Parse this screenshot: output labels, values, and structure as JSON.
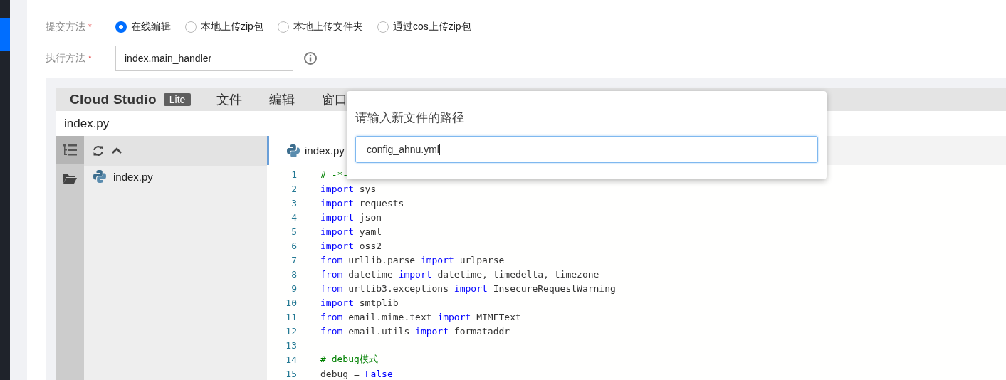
{
  "form": {
    "submit_method": {
      "label": "提交方法",
      "required_mark": "*",
      "options": [
        {
          "label": "在线编辑",
          "selected": true
        },
        {
          "label": "本地上传zip包",
          "selected": false
        },
        {
          "label": "本地上传文件夹",
          "selected": false
        },
        {
          "label": "通过cos上传zip包",
          "selected": false
        }
      ]
    },
    "handler": {
      "label": "执行方法",
      "required_mark": "*",
      "value": "index.main_handler"
    }
  },
  "ide": {
    "brand": "Cloud Studio",
    "badge": "Lite",
    "menu": [
      "文件",
      "编辑",
      "窗口"
    ],
    "title": "index.py",
    "file_tree": [
      {
        "name": "index.py",
        "selected": false
      }
    ],
    "tabs": [
      {
        "label": "index.py",
        "selected": true
      }
    ],
    "lines": [
      {
        "number": "1",
        "tokens": [
          {
            "kind": "comment",
            "text": "# -*-"
          }
        ]
      },
      {
        "number": "2",
        "tokens": [
          {
            "kind": "keyword",
            "text": "import"
          },
          {
            "kind": "plain",
            "text": " sys"
          }
        ]
      },
      {
        "number": "3",
        "tokens": [
          {
            "kind": "keyword",
            "text": "import"
          },
          {
            "kind": "plain",
            "text": " requests"
          }
        ]
      },
      {
        "number": "4",
        "tokens": [
          {
            "kind": "keyword",
            "text": "import"
          },
          {
            "kind": "plain",
            "text": " json"
          }
        ]
      },
      {
        "number": "5",
        "tokens": [
          {
            "kind": "keyword",
            "text": "import"
          },
          {
            "kind": "plain",
            "text": " yaml"
          }
        ]
      },
      {
        "number": "6",
        "tokens": [
          {
            "kind": "keyword",
            "text": "import"
          },
          {
            "kind": "plain",
            "text": " oss2"
          }
        ]
      },
      {
        "number": "7",
        "tokens": [
          {
            "kind": "keyword",
            "text": "from"
          },
          {
            "kind": "plain",
            "text": " urllib.parse "
          },
          {
            "kind": "keyword",
            "text": "import"
          },
          {
            "kind": "plain",
            "text": " urlparse"
          }
        ]
      },
      {
        "number": "8",
        "tokens": [
          {
            "kind": "keyword",
            "text": "from"
          },
          {
            "kind": "plain",
            "text": " datetime "
          },
          {
            "kind": "keyword",
            "text": "import"
          },
          {
            "kind": "plain",
            "text": " datetime, timedelta, timezone"
          }
        ]
      },
      {
        "number": "9",
        "tokens": [
          {
            "kind": "keyword",
            "text": "from"
          },
          {
            "kind": "plain",
            "text": " urllib3.exceptions "
          },
          {
            "kind": "keyword",
            "text": "import"
          },
          {
            "kind": "plain",
            "text": " InsecureRequestWarning"
          }
        ]
      },
      {
        "number": "10",
        "tokens": [
          {
            "kind": "keyword",
            "text": "import"
          },
          {
            "kind": "plain",
            "text": " smtplib"
          }
        ]
      },
      {
        "number": "11",
        "tokens": [
          {
            "kind": "keyword",
            "text": "from"
          },
          {
            "kind": "plain",
            "text": " email.mime.text "
          },
          {
            "kind": "keyword",
            "text": "import"
          },
          {
            "kind": "plain",
            "text": " MIMEText"
          }
        ]
      },
      {
        "number": "12",
        "tokens": [
          {
            "kind": "keyword",
            "text": "from"
          },
          {
            "kind": "plain",
            "text": " email.utils "
          },
          {
            "kind": "keyword",
            "text": "import"
          },
          {
            "kind": "plain",
            "text": " formataddr"
          }
        ]
      },
      {
        "number": "13"
      },
      {
        "number": "14",
        "tokens": [
          {
            "kind": "comment",
            "text": "# debug模式"
          }
        ]
      },
      {
        "number": "15",
        "tokens": [
          {
            "kind": "plain",
            "text": "debug = "
          },
          {
            "kind": "builtin",
            "text": "False"
          }
        ]
      }
    ]
  },
  "dialog": {
    "title": "请输入新文件的路径",
    "value": "config_ahnu.yml"
  }
}
